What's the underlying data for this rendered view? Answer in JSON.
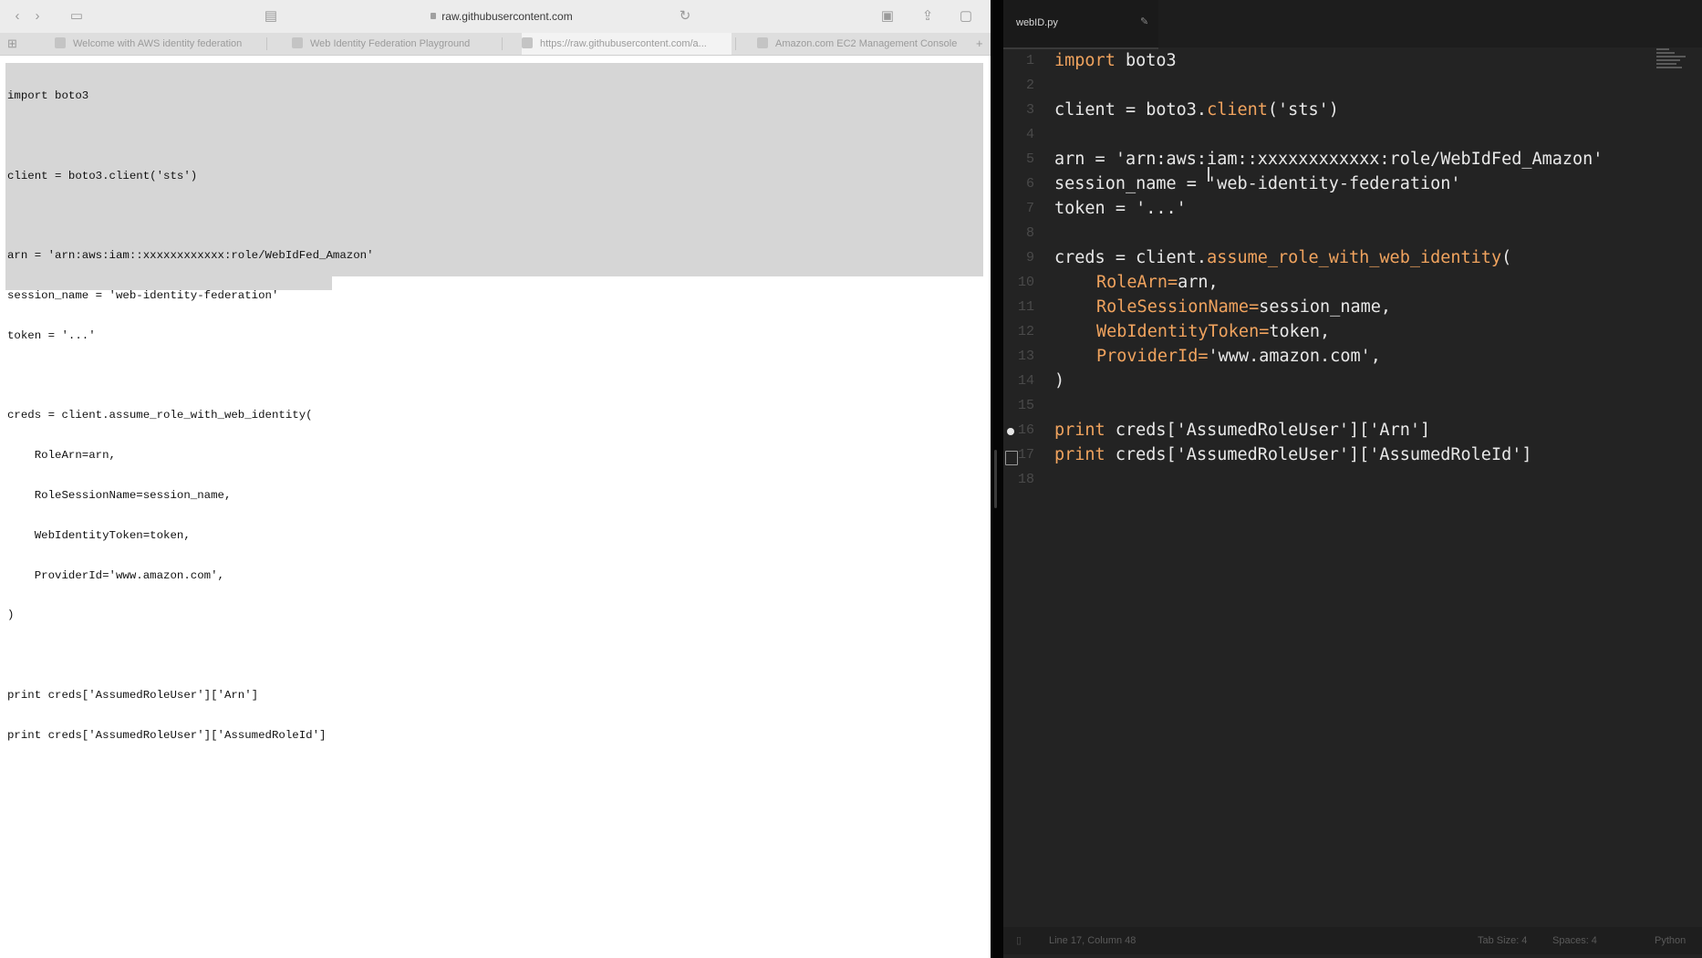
{
  "browser": {
    "url": "raw.githubusercontent.com",
    "tabs": [
      "Welcome with AWS identity federation",
      "Web Identity Federation Playground",
      "https://raw.githubusercontent.com/a...",
      "Amazon.com EC2 Management Console"
    ],
    "code_lines": [
      "import boto3",
      "",
      "client = boto3.client('sts')",
      "",
      "arn = 'arn:aws:iam::xxxxxxxxxxxx:role/WebIdFed_Amazon'",
      "session_name = 'web-identity-federation'",
      "token = '...'",
      "",
      "creds = client.assume_role_with_web_identity(",
      "    RoleArn=arn,",
      "    RoleSessionName=session_name,",
      "    WebIdentityToken=token,",
      "    ProviderId='www.amazon.com',",
      ")",
      "",
      "print creds['AssumedRoleUser']['Arn']",
      "print creds['AssumedRoleUser']['AssumedRoleId']"
    ]
  },
  "editor": {
    "tab_name": "webID.py",
    "tab_close": "✎",
    "line_numbers": [
      "1",
      "2",
      "3",
      "4",
      "5",
      "6",
      "7",
      "8",
      "9",
      "10",
      "11",
      "12",
      "13",
      "14",
      "15",
      "16",
      "17",
      "18"
    ],
    "lines": {
      "l1": {
        "kw": "import",
        "rest": " boto3"
      },
      "l3": {
        "a": "client = boto3.",
        "fn": "client",
        "b": "('sts')"
      },
      "l5": "arn = 'arn:aws:iam::xxxxxxxxxxxx:role/WebIdFed_Amazon'",
      "l6": "session_name = 'web-identity-federation'",
      "l7": "token = '...'",
      "l9": {
        "a": "creds = client.",
        "fn": "assume_role_with_web_identity",
        "b": "("
      },
      "l10": {
        "k": "RoleArn=",
        "v": "arn,"
      },
      "l11": {
        "k": "RoleSessionName=",
        "v": "session_name,"
      },
      "l12": {
        "k": "WebIdentityToken=",
        "v": "token,"
      },
      "l13": {
        "k": "ProviderId=",
        "v": "'www.amazon.com',"
      },
      "l14": ")",
      "l16": {
        "kw": "print",
        "rest": " creds['AssumedRoleUser']['Arn']"
      },
      "l17": {
        "kw": "print",
        "rest": " creds['AssumedRoleUser']['AssumedRoleId']"
      }
    },
    "status": {
      "position": "Line 17, Column 48",
      "tabsize": "Tab Size: 4",
      "encoding": "Spaces: 4",
      "syntax": "Python"
    }
  }
}
